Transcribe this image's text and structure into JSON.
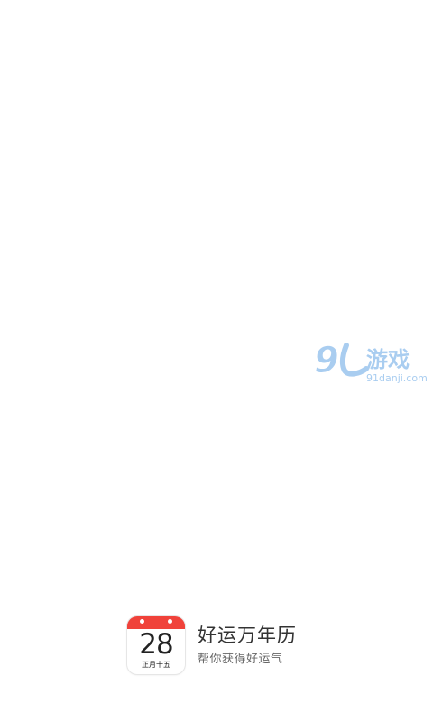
{
  "watermark": {
    "logo_number": "9",
    "logo_text": "游戏",
    "site": "91danji.com"
  },
  "calendar_icon": {
    "day": "28",
    "lunar_date": "正月十五"
  },
  "app": {
    "name": "好运万年历",
    "slogan": "帮你获得好运气"
  },
  "colors": {
    "background": "#ffffff",
    "calendar_red": "#f0423a",
    "watermark_blue": "#a9cdf0"
  }
}
